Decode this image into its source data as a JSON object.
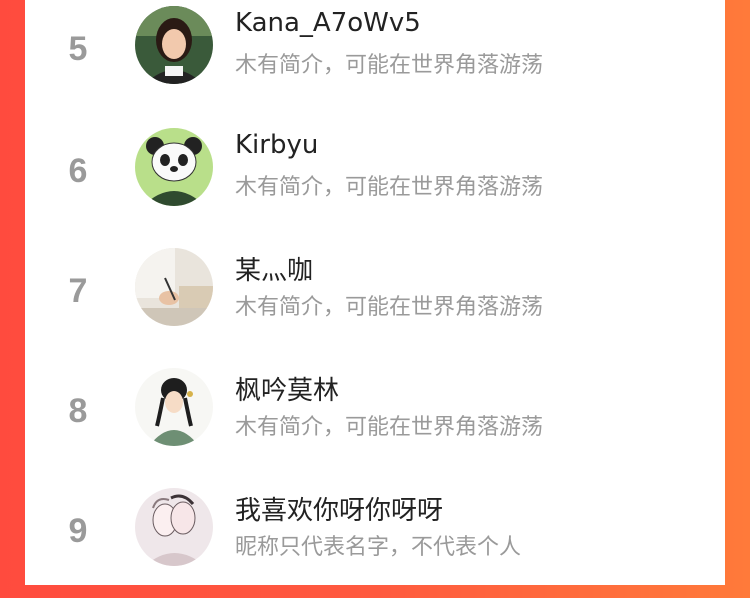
{
  "leaderboard": [
    {
      "rank": "5",
      "name": "Kana_A7oWv5",
      "bio": "木有简介，可能在世界角落游荡",
      "avatar_icon": "woman-photo-avatar"
    },
    {
      "rank": "6",
      "name": "Kirbyu",
      "bio": "木有简介，可能在世界角落游荡",
      "avatar_icon": "panda-avatar"
    },
    {
      "rank": "7",
      "name": "某灬咖",
      "bio": "木有简介，可能在世界角落游荡",
      "avatar_icon": "writing-hand-avatar"
    },
    {
      "rank": "8",
      "name": "枫吟莫林",
      "bio": "木有简介，可能在世界角落游荡",
      "avatar_icon": "anime-girl-avatar"
    },
    {
      "rank": "9",
      "name": "我喜欢你呀你呀呀",
      "bio": "昵称只代表名字，不代表个人",
      "avatar_icon": "sketch-couple-avatar"
    }
  ]
}
